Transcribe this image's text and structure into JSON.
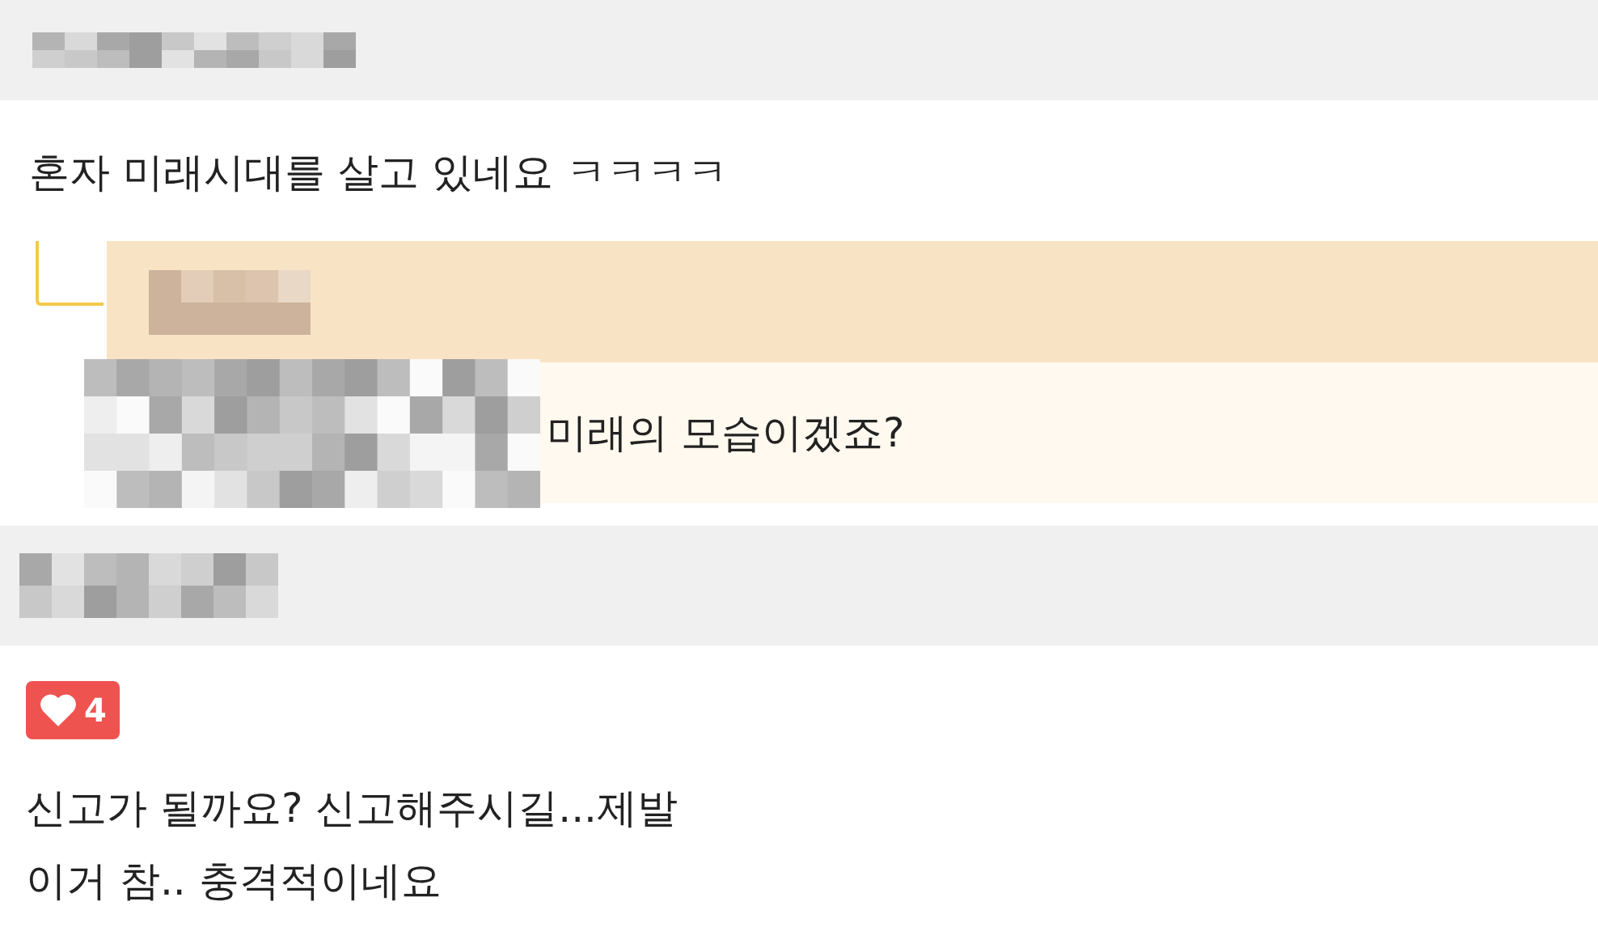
{
  "comments": [
    {
      "text_lines": [
        "혼자 미래시대를 살고 있네요 ㅋㅋㅋㅋ"
      ],
      "replies": [
        {
          "text": "미래의 모습이겠죠?"
        }
      ]
    },
    {
      "likes": "4",
      "text_lines": [
        "신고가 될까요? 신고해주시길...제발",
        "이거 참.. 충격적이네요"
      ]
    }
  ]
}
